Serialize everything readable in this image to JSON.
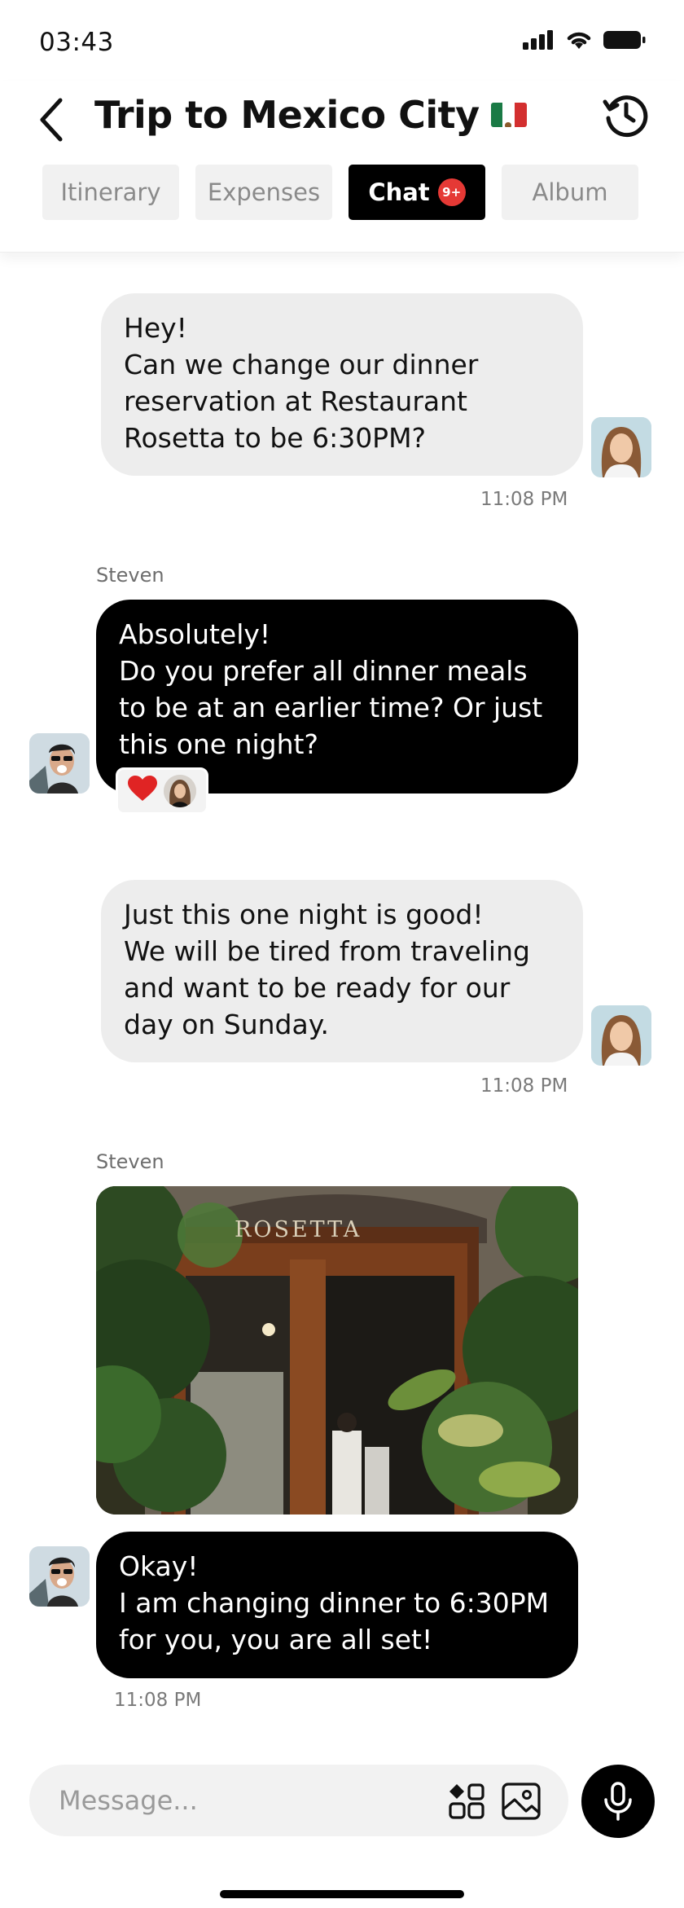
{
  "status_bar": {
    "time": "03:43"
  },
  "header": {
    "title": "Trip to Mexico City",
    "tabs": [
      {
        "label": "Itinerary"
      },
      {
        "label": "Expenses"
      },
      {
        "label": "Chat",
        "badge": "9+"
      },
      {
        "label": "Album"
      }
    ]
  },
  "messages": [
    {
      "text": "Hey!\nCan we change our dinner reservation at Restaurant Rosetta to be 6:30PM?",
      "time": "11:08 PM"
    },
    {
      "sender": "Steven",
      "text": "Absolutely!\nDo you prefer all dinner meals to be at an earlier time? Or just this one night?",
      "reaction": "❤️"
    },
    {
      "text": "Just this one night is good!\nWe will be tired from traveling and want to be ready for our day on Sunday.",
      "time": "11:08 PM"
    },
    {
      "sender": "Steven",
      "photo_sign": "ROSETTA"
    },
    {
      "text": "Okay!\nI am changing dinner to 6:30PM for you, you are all set!",
      "time": "11:08 PM"
    }
  ],
  "composer": {
    "placeholder": "Message..."
  },
  "colors": {
    "accent": "#000000",
    "badge": "#e53935",
    "my_bubble": "#ededed",
    "their_bubble": "#000000"
  },
  "icons": [
    "back-icon",
    "history-icon",
    "apps-icon",
    "gallery-icon",
    "microphone-icon"
  ]
}
